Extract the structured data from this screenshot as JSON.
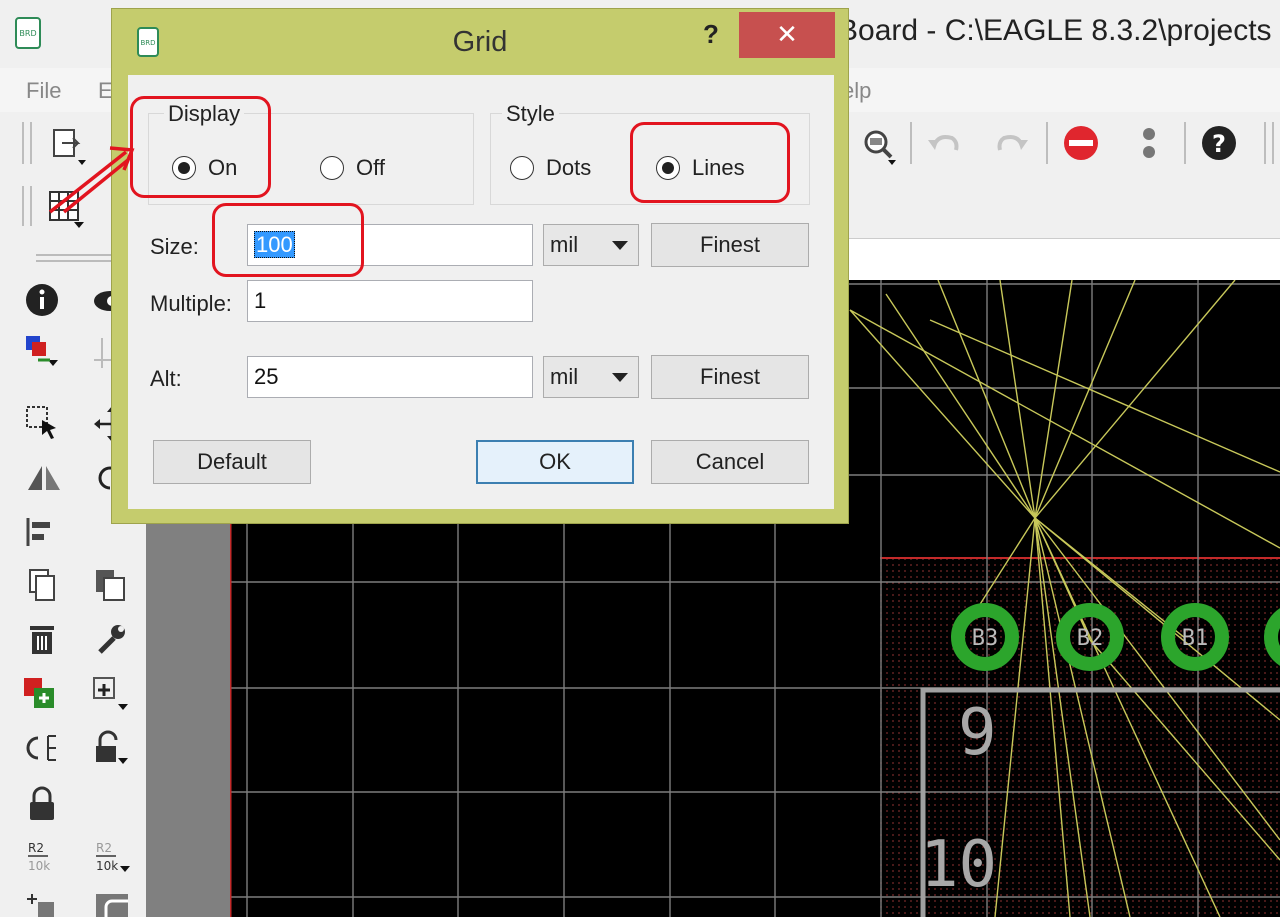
{
  "window": {
    "title": "Board - C:\\EAGLE 8.3.2\\projects",
    "menu": [
      "File",
      "E",
      "elp"
    ]
  },
  "dialog": {
    "title": "Grid",
    "help": "?",
    "close": "✕",
    "display": {
      "label": "Display",
      "on": "On",
      "off": "Off",
      "selected": "On"
    },
    "style": {
      "label": "Style",
      "dots": "Dots",
      "lines": "Lines",
      "selected": "Lines"
    },
    "size": {
      "label": "Size:",
      "value": "100",
      "unit": "mil",
      "finest": "Finest"
    },
    "multiple": {
      "label": "Multiple:",
      "value": "1"
    },
    "alt": {
      "label": "Alt:",
      "value": "25",
      "unit": "mil",
      "finest": "Finest"
    },
    "buttons": {
      "default": "Default",
      "ok": "OK",
      "cancel": "Cancel"
    }
  },
  "board": {
    "pads": [
      "B3",
      "B2",
      "B1"
    ],
    "labels": [
      "9",
      "10"
    ]
  },
  "colors": {
    "dialog_frame": "#c5cc6d",
    "close_button": "#c7504f",
    "annotation": "#e2141f",
    "pad_green": "#2ca52c",
    "airwire": "#c8c85a"
  }
}
